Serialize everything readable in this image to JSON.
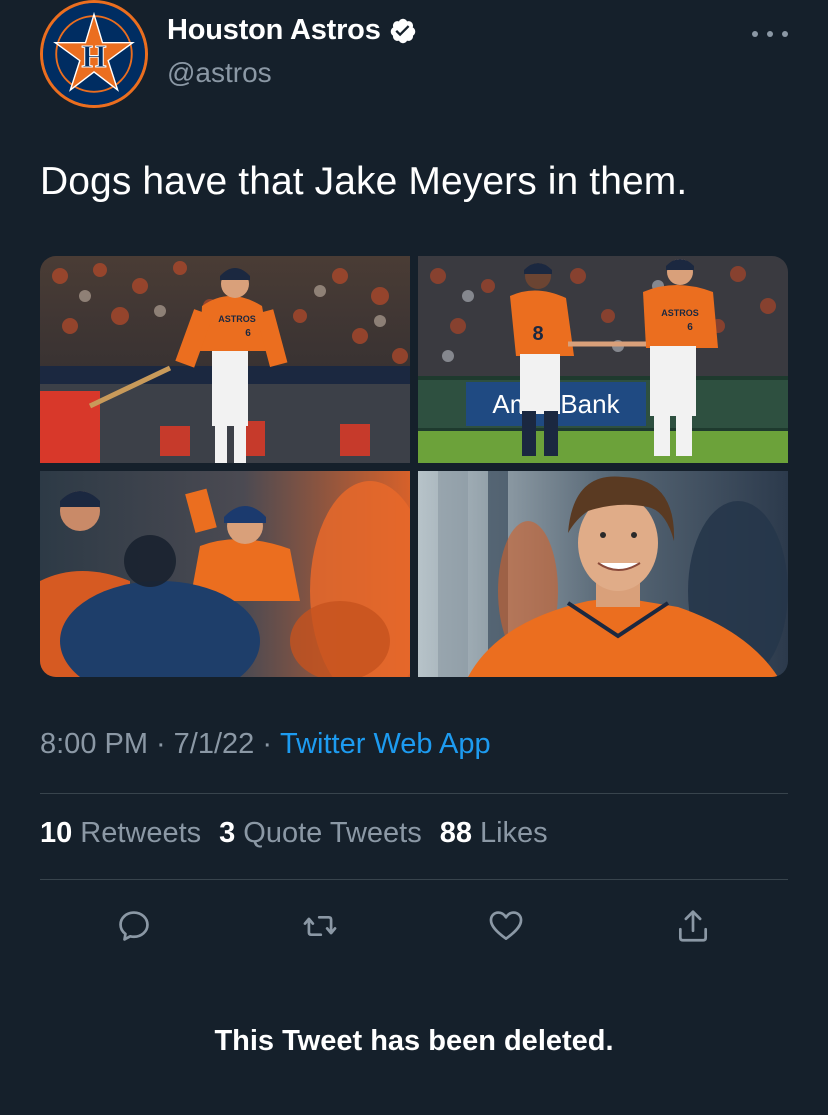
{
  "tweet": {
    "author": {
      "display_name": "Houston Astros",
      "handle": "@astros",
      "verified": true,
      "avatar_icon": "astros-logo-icon",
      "avatar_letter": "H"
    },
    "text": "Dogs have that Jake Meyers in them.",
    "media": {
      "count": 4,
      "photo_1": {
        "jersey_text": "ASTROS",
        "jersey_number": "6"
      },
      "photo_2": {
        "jersey_number_left": "8",
        "jersey_text_right": "ASTROS",
        "jersey_number_right": "6",
        "ad_banner": "AmeriBank"
      },
      "photo_3": {},
      "photo_4": {}
    },
    "time": "8:00 PM",
    "date": "7/1/22",
    "separator": "·",
    "source": "Twitter Web App",
    "stats": {
      "retweets_count": "10",
      "retweets_label": "Retweets",
      "quotes_count": "3",
      "quotes_label": "Quote Tweets",
      "likes_count": "88",
      "likes_label": "Likes"
    },
    "actions": [
      "reply-icon",
      "retweet-icon",
      "like-icon",
      "share-icon"
    ]
  },
  "notice": "This Tweet has been deleted.",
  "colors": {
    "background": "#15202b",
    "text": "#ffffff",
    "secondary_text": "#8b98a5",
    "link": "#1d9bf0",
    "divider": "#38444d",
    "astros_orange": "#eb6e1f",
    "astros_navy": "#002d62"
  }
}
